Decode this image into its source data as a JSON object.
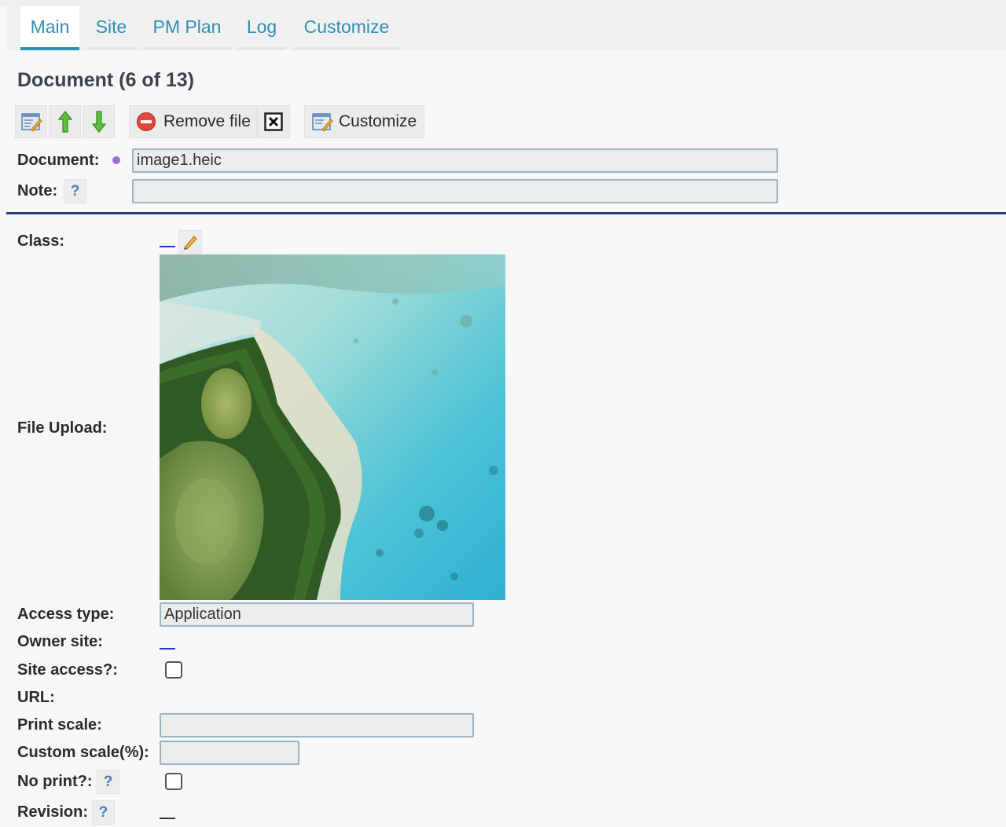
{
  "tabs": [
    {
      "label": "Main",
      "active": true
    },
    {
      "label": "Site",
      "active": false
    },
    {
      "label": "PM Plan",
      "active": false
    },
    {
      "label": "Log",
      "active": false
    },
    {
      "label": "Customize",
      "active": false
    }
  ],
  "heading": "Document (6 of 13)",
  "toolbar": {
    "edit_icon": "edit-form-icon",
    "up_icon": "arrow-up-icon",
    "down_icon": "arrow-down-icon",
    "remove_label": "Remove file",
    "remove_icon": "remove-circle-icon",
    "close_icon": "close-box-icon",
    "customize_label": "Customize",
    "customize_icon": "customize-form-icon"
  },
  "fields": {
    "document_label": "Document:",
    "document_value": "image1.heic",
    "note_label": "Note:",
    "note_value": "",
    "class_label": "Class:",
    "file_upload_label": "File Upload:",
    "access_type_label": "Access type:",
    "access_type_value": "Application",
    "owner_site_label": "Owner site:",
    "site_access_label": "Site access?:",
    "url_label": "URL:",
    "print_scale_label": "Print scale:",
    "print_scale_value": "",
    "custom_scale_label": "Custom scale(%):",
    "custom_scale_value": "",
    "no_print_label": "No print?:",
    "revision_label": "Revision:"
  },
  "help_symbol": "?",
  "colors": {
    "tab_text": "#2f8fb0",
    "divider": "#2c3e80",
    "link": "#1a3cc8",
    "required_dot": "#9b6ddb"
  }
}
